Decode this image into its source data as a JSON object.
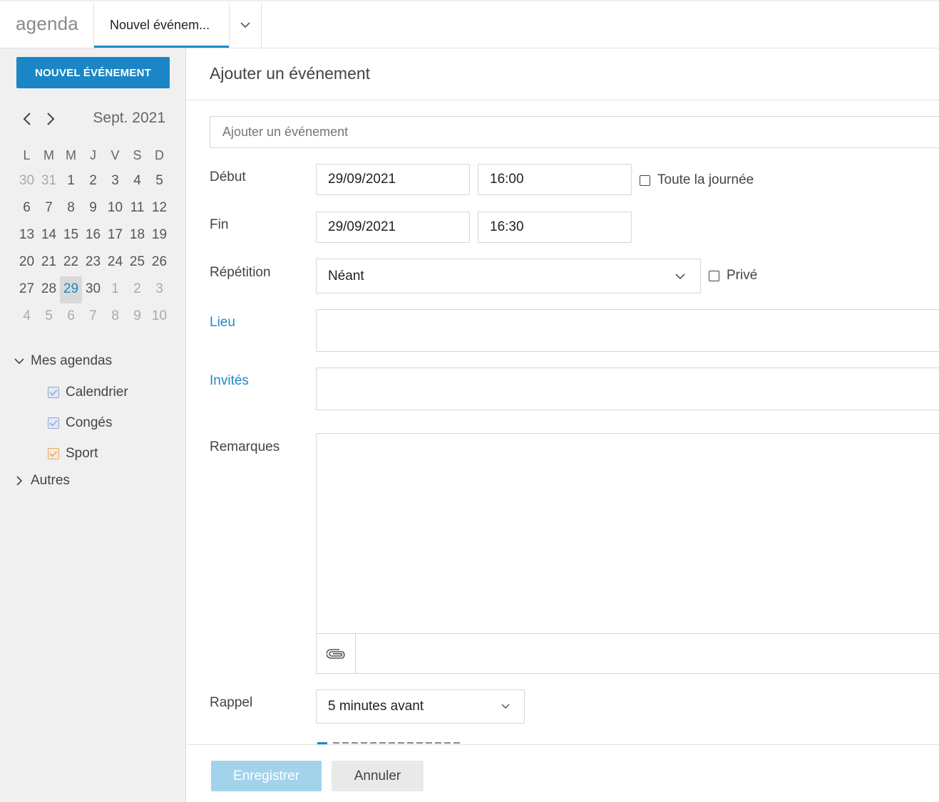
{
  "app": {
    "title": "agenda"
  },
  "tabs": [
    {
      "label": "Nouvel événem..."
    }
  ],
  "sidebar": {
    "new_event_button": "NOUVEL ÉVÉNEMENT",
    "month_label": "Sept. 2021",
    "weekdays": [
      "L",
      "M",
      "M",
      "J",
      "V",
      "S",
      "D"
    ],
    "weeks": [
      [
        "30",
        "31",
        "1",
        "2",
        "3",
        "4",
        "5"
      ],
      [
        "6",
        "7",
        "8",
        "9",
        "10",
        "11",
        "12"
      ],
      [
        "13",
        "14",
        "15",
        "16",
        "17",
        "18",
        "19"
      ],
      [
        "20",
        "21",
        "22",
        "23",
        "24",
        "25",
        "26"
      ],
      [
        "27",
        "28",
        "29",
        "30",
        "1",
        "2",
        "3"
      ],
      [
        "4",
        "5",
        "6",
        "7",
        "8",
        "9",
        "10"
      ]
    ],
    "selected_day": "29",
    "my_calendars_label": "Mes agendas",
    "calendars": [
      {
        "label": "Calendrier",
        "color": "#8fa9d6",
        "checked": true
      },
      {
        "label": "Congés",
        "color": "#8fa9d6",
        "checked": true
      },
      {
        "label": "Sport",
        "color": "#e3a96a",
        "checked": true
      }
    ],
    "others_label": "Autres"
  },
  "form": {
    "header": "Ajouter un événement",
    "title_placeholder": "Ajouter un événement",
    "start_label": "Début",
    "start_date": "29/09/2021",
    "start_time": "16:00",
    "all_day_label": "Toute la journée",
    "end_label": "Fin",
    "end_date": "29/09/2021",
    "end_time": "16:30",
    "repeat_label": "Répétition",
    "repeat_value": "Néant",
    "private_label": "Privé",
    "location_label": "Lieu",
    "guests_label": "Invités",
    "notes_label": "Remarques",
    "reminder_label": "Rappel",
    "reminder_value": "5 minutes avant"
  },
  "footer": {
    "save_label": "Enregistrer",
    "cancel_label": "Annuler"
  },
  "colors": {
    "accent": "#1a86c6",
    "save_disabled": "#a3d3ea"
  }
}
